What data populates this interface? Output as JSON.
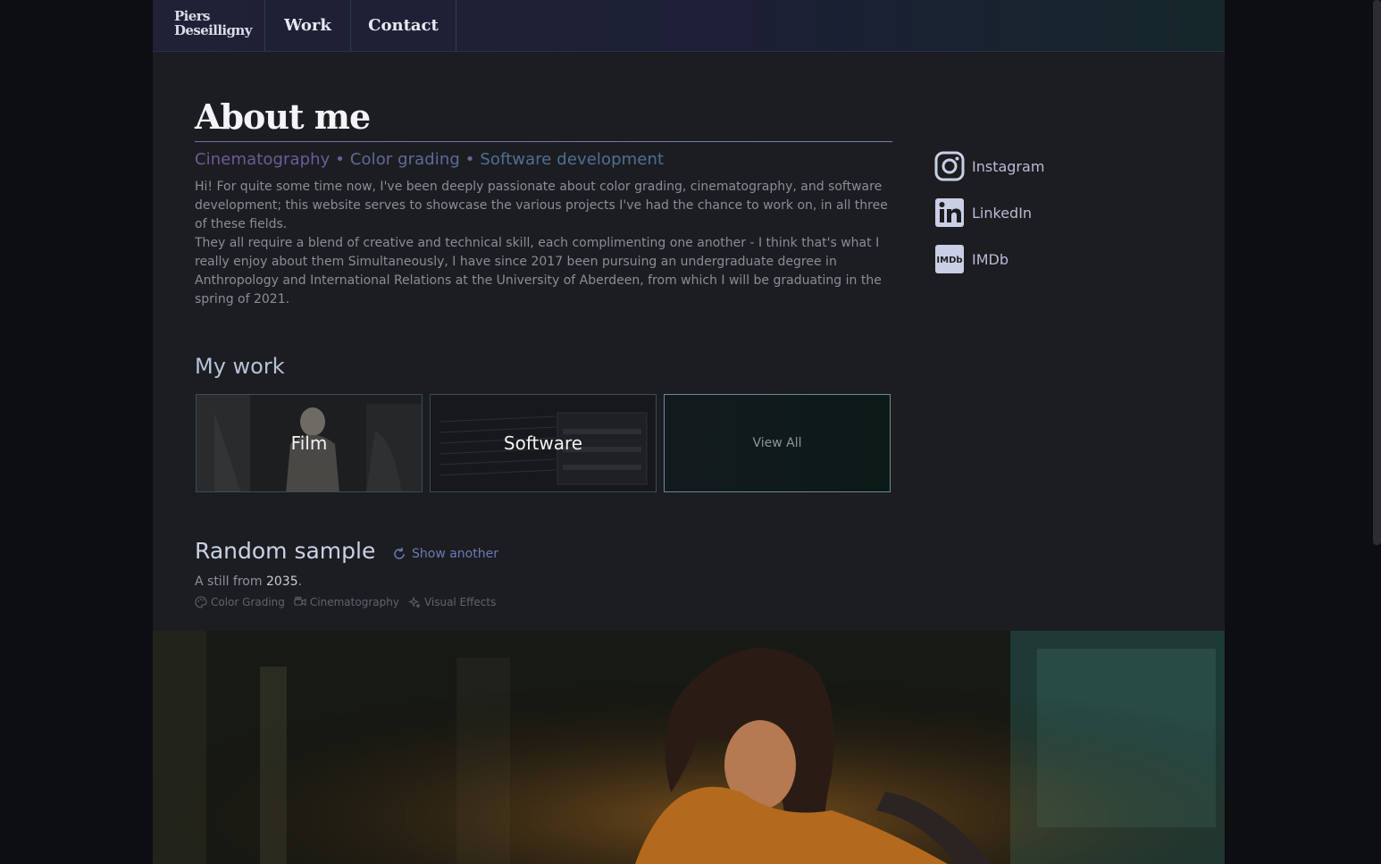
{
  "nav": {
    "logo": "Piers Deseilligny",
    "links": [
      {
        "label": "Work"
      },
      {
        "label": "Contact"
      }
    ]
  },
  "about": {
    "title": "About me",
    "subtitle_parts": [
      "Cinematography",
      "Color grading",
      "Software development"
    ],
    "separator": " • ",
    "bio": [
      "Hi! For quite some time now, I've been deeply passionate about color grading, cinematography, and software development; this website serves to showcase the various projects I've had the chance to work on, in all three of these fields.",
      "They all require a blend of creative and technical skill, each complimenting one another - I think that's what I really enjoy about them Simultaneously, I have since 2017 been pursuing an undergraduate degree in Anthropology and International Relations at the University of Aberdeen, from which I will be graduating in the spring of 2021."
    ]
  },
  "social": [
    {
      "label": "Instagram",
      "icon": "instagram-icon"
    },
    {
      "label": "LinkedIn",
      "icon": "linkedin-icon"
    },
    {
      "label": "IMDb",
      "icon": "imdb-icon"
    }
  ],
  "my_work": {
    "title": "My work",
    "cards": [
      {
        "label": "Film"
      },
      {
        "label": "Software"
      },
      {
        "label": "View All"
      }
    ]
  },
  "random_sample": {
    "title": "Random sample",
    "show_another": "Show another",
    "caption_prefix": "A still from ",
    "caption_year": "2035",
    "caption_suffix": ".",
    "tags": [
      {
        "label": "Color Grading",
        "icon": "palette-icon"
      },
      {
        "label": "Cinematography",
        "icon": "camera-icon"
      },
      {
        "label": "Visual Effects",
        "icon": "sparkle-icon"
      }
    ]
  },
  "colors": {
    "background": "#0d0e11",
    "page": "#1c1d21",
    "accent_purple": "#6c5b9a",
    "accent_blue": "#6b7ab9"
  }
}
